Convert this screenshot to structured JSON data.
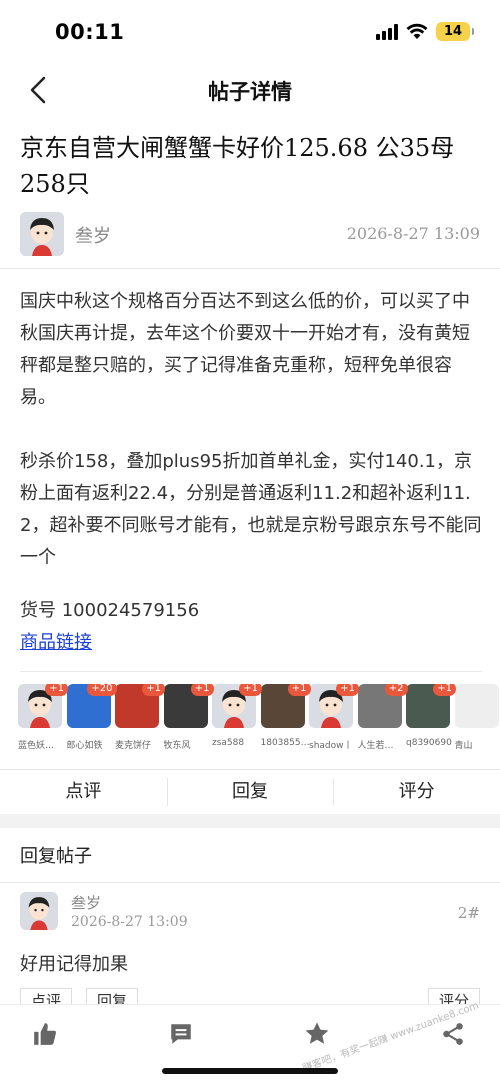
{
  "status": {
    "time": "00:11",
    "battery": "14"
  },
  "nav": {
    "title": "帖子详情"
  },
  "post": {
    "title": "京东自营大闸蟹蟹卡好价125.68 公35母258只",
    "author": "叁岁",
    "date": "2026-8-27 13:09",
    "paragraph1": "国庆中秋这个规格百分百达不到这么低的价，可以买了中秋国庆再计提，去年这个价要双十一开始才有，没有黄短秤都是整只赔的，买了记得准备克重称，短秤免单很容易。",
    "paragraph2": "秒杀价158，叠加plus95折加首单礼金，实付140.1，京粉上面有返利22.4，分别是普通返利11.2和超补返利11.2，超补要不同账号才能有，也就是京粉号跟京东号不能同一个",
    "item_no": "货号 100024579156",
    "link_text": "商品链接"
  },
  "raters": [
    {
      "name": "蓝色妖…",
      "badge": "+1",
      "color": "#d9dde3"
    },
    {
      "name": "郎心如铁",
      "badge": "+20",
      "color": "#2e6fd1"
    },
    {
      "name": "麦克饼仔",
      "badge": "+1",
      "color": "#c0392b"
    },
    {
      "name": "牧东风",
      "badge": "+1",
      "color": "#3a3a3a"
    },
    {
      "name": "zsa588",
      "badge": "+1",
      "color": "#d9dde3"
    },
    {
      "name": "1803855…",
      "badge": "+1",
      "color": "#5a4636"
    },
    {
      "name": "shadow丨",
      "badge": "+1",
      "color": "#d9dde3"
    },
    {
      "name": "人生若…",
      "badge": "+2",
      "color": "#777"
    },
    {
      "name": "q8390690",
      "badge": "+1",
      "color": "#4a5a50"
    },
    {
      "name": "青山",
      "badge": "",
      "color": "#eee"
    }
  ],
  "actions": {
    "comment": "点评",
    "reply": "回复",
    "rate": "评分"
  },
  "reply_section": {
    "header": "回复帖子"
  },
  "reply": {
    "author": "叁岁",
    "date": "2026-8-27 13:09",
    "floor": "2#",
    "text": "好用记得加果",
    "comment_btn": "点评",
    "reply_btn": "回复",
    "rate_btn": "评分"
  },
  "watermark": "赚客吧，有奖一起赚 www.zuanke8.com",
  "colors": {
    "link": "#1a3fd6",
    "badge": "#e9583d",
    "battery": "#f5d24a"
  }
}
